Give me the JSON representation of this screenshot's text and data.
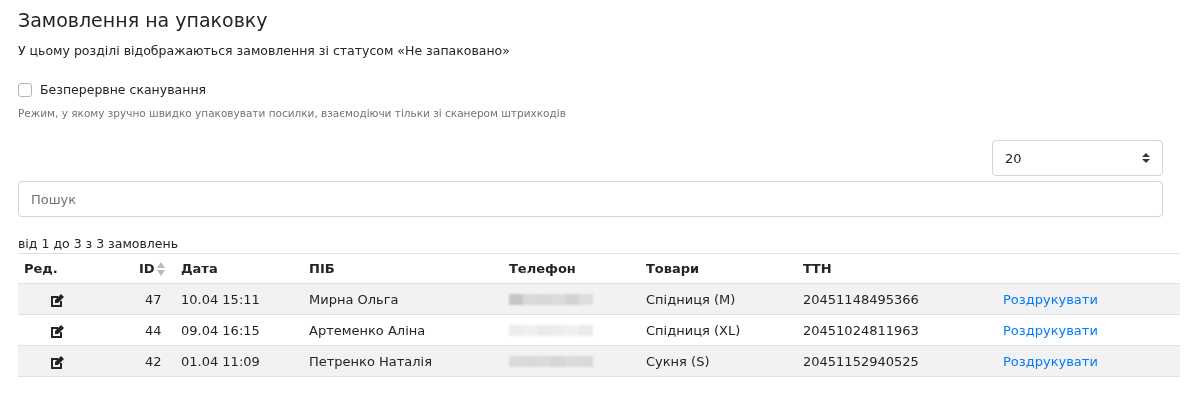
{
  "title": "Замовлення на упаковку",
  "description": "У цьому розділі відображаються замовлення зі статусом «Не запаковано»",
  "continuous_scan": {
    "label": "Безперервне сканування",
    "checked": false,
    "hint": "Режим, у якому зручно швидко упаковувати посилки, взаємодіючи тільки зі сканером штрихкодів"
  },
  "page_size": {
    "value": "20"
  },
  "search": {
    "placeholder": "Пошук"
  },
  "summary": "від 1 до 3 з 3 замовлень",
  "table": {
    "columns": [
      "Ред.",
      "ID",
      "Дата",
      "ПІБ",
      "Телефон",
      "Товари",
      "ТТН"
    ],
    "rows": [
      {
        "id": "47",
        "date": "10.04 15:11",
        "name": "Мирна Ольга",
        "goods": "Спідниця (M)",
        "ttn": "20451148495366",
        "action": "Роздрукувати"
      },
      {
        "id": "44",
        "date": "09.04 16:15",
        "name": "Артеменко Аліна",
        "goods": "Спідниця (XL)",
        "ttn": "20451024811963",
        "action": "Роздрукувати"
      },
      {
        "id": "42",
        "date": "01.04 11:09",
        "name": "Петренко Наталія",
        "goods": "Сукня (S)",
        "ttn": "20451152940525",
        "action": "Роздрукувати"
      }
    ]
  }
}
